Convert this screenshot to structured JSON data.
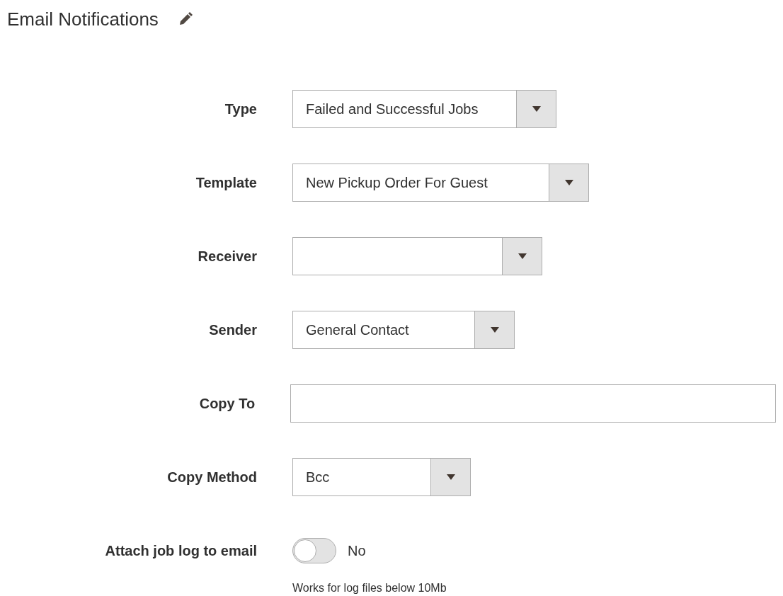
{
  "title": "Email Notifications",
  "fields": [
    {
      "kind": "select",
      "label": "Type",
      "value": "Failed and Successful Jobs"
    },
    {
      "kind": "select",
      "label": "Template",
      "value": "New Pickup Order For Guest"
    },
    {
      "kind": "select",
      "label": "Receiver"
    },
    {
      "kind": "select",
      "label": "Sender",
      "value": "General Contact"
    },
    {
      "kind": "text",
      "label": "Copy To"
    },
    {
      "kind": "select",
      "label": "Copy Method",
      "value": "Bcc"
    },
    {
      "kind": "toggle",
      "label": "Attach job log to email",
      "on": false,
      "state_label": "No",
      "note": "Works for log files below 10Mb"
    }
  ]
}
